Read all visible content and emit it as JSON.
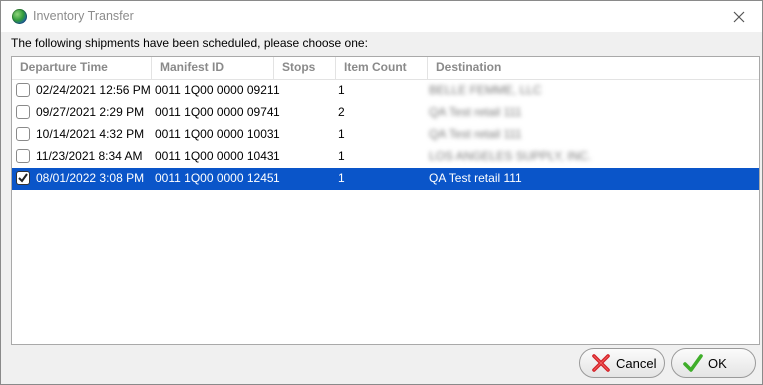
{
  "window": {
    "title": "Inventory Transfer"
  },
  "prompt": "The following shipments have been scheduled, please choose one:",
  "table": {
    "columns": [
      "Departure Time",
      "Manifest ID",
      "Stops",
      "Item Count",
      "Destination"
    ],
    "rows": [
      {
        "checked": false,
        "selected": false,
        "departure": "02/24/2021 12:56 PM",
        "manifest": "0011 1Q00 0000 0921",
        "stops": "1",
        "items": "1",
        "destination": "BELLE FEMME, LLC",
        "blurred": true
      },
      {
        "checked": false,
        "selected": false,
        "departure": "09/27/2021 2:29 PM",
        "manifest": "0011 1Q00 0000 0974",
        "stops": "1",
        "items": "2",
        "destination": "QA Test retail 111",
        "blurred": true
      },
      {
        "checked": false,
        "selected": false,
        "departure": "10/14/2021 4:32 PM",
        "manifest": "0011 1Q00 0000 1003",
        "stops": "1",
        "items": "1",
        "destination": "QA Test retail 111",
        "blurred": true
      },
      {
        "checked": false,
        "selected": false,
        "departure": "11/23/2021 8:34 AM",
        "manifest": "0011 1Q00 0000 1043",
        "stops": "1",
        "items": "1",
        "destination": "LOS ANGELES SUPPLY, INC.",
        "blurred": true
      },
      {
        "checked": true,
        "selected": true,
        "departure": "08/01/2022 3:08 PM",
        "manifest": "0011 1Q00 0000 1245",
        "stops": "1",
        "items": "1",
        "destination": "QA Test retail 111",
        "blurred": false
      }
    ]
  },
  "buttons": {
    "cancel": "Cancel",
    "ok": "OK"
  },
  "colors": {
    "selection": "#0a55c9",
    "cancel_icon": "#d21f26",
    "ok_icon": "#3fae2a"
  }
}
